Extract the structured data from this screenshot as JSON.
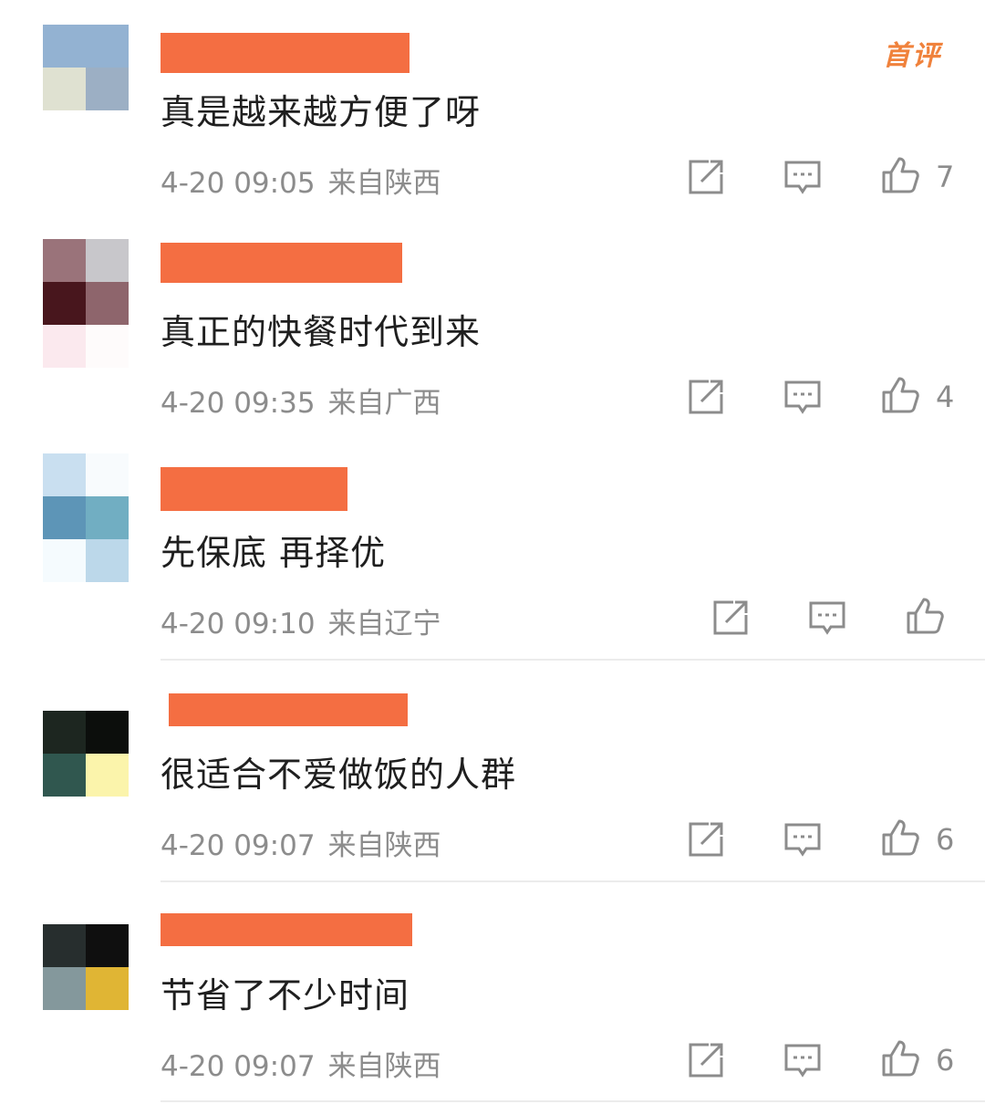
{
  "badge": "首评",
  "comments": [
    {
      "text": "真是越来越方便了呀",
      "time": "4-20 09:05",
      "location": "来自陕西",
      "likes": "7",
      "avatar": [
        "#93b2d2",
        "#93b2d2",
        "#dfe1d1",
        "#9cafc4"
      ]
    },
    {
      "text": "真正的快餐时代到来",
      "time": "4-20 09:35",
      "location": "来自广西",
      "likes": "4",
      "avatar": [
        "#9a737a",
        "#c8c7cb",
        "#48161d",
        "#8e656c",
        "#fbe9ee",
        "#fefbfb"
      ]
    },
    {
      "text": "先保底 再择优",
      "time": "4-20 09:10",
      "location": "来自辽宁",
      "likes": "",
      "avatar": [
        "#c9dff0",
        "#f8fbfd",
        "#5d95b7",
        "#71aec2",
        "#f5fbfe",
        "#bcd8ea"
      ]
    },
    {
      "text": "很适合不爱做饭的人群",
      "time": "4-20 09:07",
      "location": "来自陕西",
      "likes": "6",
      "avatar": [
        "#1d2620",
        "#0c0e0c",
        "#30574f",
        "#fbf4ab"
      ]
    },
    {
      "text": "节省了不少时间",
      "time": "4-20 09:07",
      "location": "来自陕西",
      "likes": "6",
      "avatar": [
        "#272e2e",
        "#0f0f0f",
        "#84989c",
        "#e0b534"
      ]
    }
  ],
  "icon_names": {
    "share": "share-icon",
    "reply": "comment-icon",
    "like": "thumbs-up-icon"
  }
}
